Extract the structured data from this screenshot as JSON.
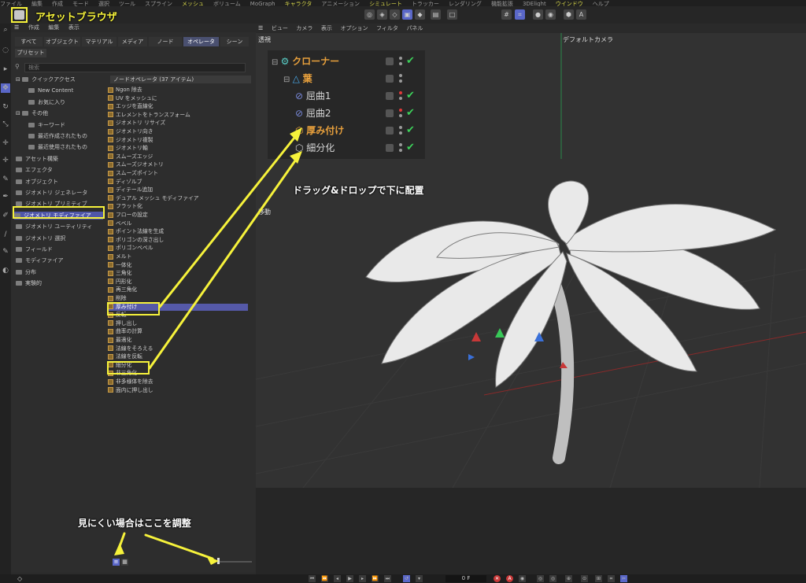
{
  "menu_bar": [
    "ファイル",
    "編集",
    "作成",
    "モード",
    "選択",
    "ツール",
    "スプライン",
    "メッシュ",
    "ボリューム",
    "MoGraph",
    "キャラクタ",
    "アニメーション",
    "シミュレート",
    "トラッカー",
    "レンダリング",
    "機能拡張",
    "3DElight",
    "ウインドウ",
    "ヘルプ"
  ],
  "asset_browser": {
    "title": "アセットブラウザ",
    "panel_menu": [
      "作成",
      "編集",
      "表示"
    ],
    "tabs": [
      "すべて",
      "オブジェクト",
      "マテリアル",
      "メディア",
      "ノード",
      "オペレータ",
      "シーン"
    ],
    "active_tab": "オペレータ",
    "presets_label": "プリセット",
    "search_placeholder": "検索",
    "tree": [
      {
        "label": "クイックアクセス"
      },
      {
        "label": "New Content"
      },
      {
        "label": "お気に入り"
      },
      {
        "label": "その他"
      },
      {
        "label": "キーワード"
      },
      {
        "label": "最近作成されたもの"
      },
      {
        "label": "最近使用されたもの"
      },
      {
        "label": "アセット構築"
      },
      {
        "label": "エフェクタ"
      },
      {
        "label": "オブジェクト"
      },
      {
        "label": "ジオメトリ ジェネレータ"
      },
      {
        "label": "ジオメトリ プリミティブ"
      },
      {
        "label": "ジオメトリ モディファイア"
      },
      {
        "label": "ジオメトリ ユーティリティ"
      },
      {
        "label": "ジオメトリ 選択"
      },
      {
        "label": "フィールド"
      },
      {
        "label": "モディファイア"
      },
      {
        "label": "分布"
      },
      {
        "label": "実験的"
      }
    ],
    "selected_tree_item": "ジオメトリ モディファイア",
    "list_header": "ノードオペレータ (37 アイテム)",
    "list_items": [
      "Ngon 除去",
      "UV をメッシュに",
      "エッジを直線化",
      "エレメントをトランスフォーム",
      "ジオメトリ リサイズ",
      "ジオメトリ向き",
      "ジオメトリ複製",
      "ジオメトリ軸",
      "スムーズエッジ",
      "スムーズジオメトリ",
      "スムーズポイント",
      "ディゾルブ",
      "ディテール追加",
      "デュアル メッシュ モディファイア",
      "フラット化",
      "フローの設定",
      "ベベル",
      "ポイント法線を生成",
      "ポリゴンの深さ出し",
      "ポリゴンベベル",
      "メルト",
      "一体化",
      "三角化",
      "円形化",
      "再三角化",
      "削除",
      "厚み付け",
      "反転",
      "押し出し",
      "曲率の計算",
      "最適化",
      "法線をそろえる",
      "法線を反転",
      "細分化",
      "非三角化",
      "非多様体を除去",
      "面内に押し出し"
    ],
    "selected_list_item": "厚み付け"
  },
  "viewport": {
    "menu": [
      "ビュー",
      "カメラ",
      "表示",
      "オプション",
      "フィルタ",
      "パネル"
    ],
    "view_name": "透視",
    "camera_label": "デフォルトカメラ",
    "move_label": "移動"
  },
  "object_manager": {
    "rows": [
      {
        "name": "クローナー",
        "color": "orange"
      },
      {
        "name": "葉",
        "color": "orange"
      },
      {
        "name": "屈曲1",
        "color": "gray"
      },
      {
        "name": "屈曲2",
        "color": "gray"
      },
      {
        "name": "厚み付け",
        "color": "orange"
      },
      {
        "name": "細分化",
        "color": "gray"
      }
    ]
  },
  "annotations": {
    "drag_drop": "ドラッグ&ドロップで下に配置",
    "adjust_hint": "見にくい場合はここを調整"
  },
  "timeline": {
    "frame": "0 F"
  },
  "colors": {
    "annotation_yellow": "#f6f23b",
    "selection_blue": "#4f56a8",
    "orange_object": "#e8a03c",
    "check_green": "#3dd05a"
  }
}
